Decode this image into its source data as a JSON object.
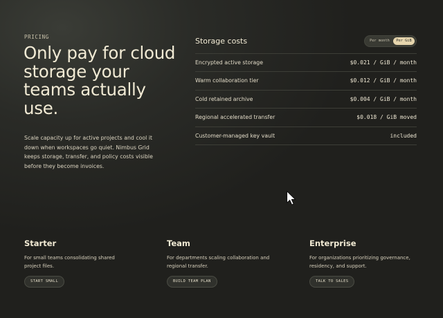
{
  "hero": {
    "eyebrow": "PRICING",
    "headline": "Only pay for cloud storage your teams actually use.",
    "description": "Scale capacity up for active projects and cool it down when workspaces go quiet. Nimbus Grid keeps storage, transfer, and policy costs visible before they become invoices."
  },
  "storage_costs": {
    "title": "Storage costs",
    "toggle": {
      "option_month": "Per month",
      "option_gib": "Per GiB",
      "selected": "Per GiB"
    },
    "rows": [
      {
        "name": "Encrypted active storage",
        "price": "$0.021 / GiB / month"
      },
      {
        "name": "Warm collaboration tier",
        "price": "$0.012 / GiB / month"
      },
      {
        "name": "Cold retained archive",
        "price": "$0.004 / GiB / month"
      },
      {
        "name": "Regional accelerated transfer",
        "price": "$0.018 / GiB moved"
      },
      {
        "name": "Customer-managed key vault",
        "price": "included"
      }
    ]
  },
  "plans": [
    {
      "name": "Starter",
      "description": "For small teams consolidating shared project files.",
      "cta": "START SMALL"
    },
    {
      "name": "Team",
      "description": "For departments scaling collaboration and regional transfer.",
      "cta": "BUILD TEAM PLAN"
    },
    {
      "name": "Enterprise",
      "description": "For organizations prioritizing governance, residency, and support.",
      "cta": "TALK TO SALES"
    }
  ],
  "colors": {
    "accent": "#e6d5ad",
    "background": "#242521",
    "text": "#f1ead4"
  },
  "icons": {
    "pointer": "mouse-cursor-icon"
  }
}
